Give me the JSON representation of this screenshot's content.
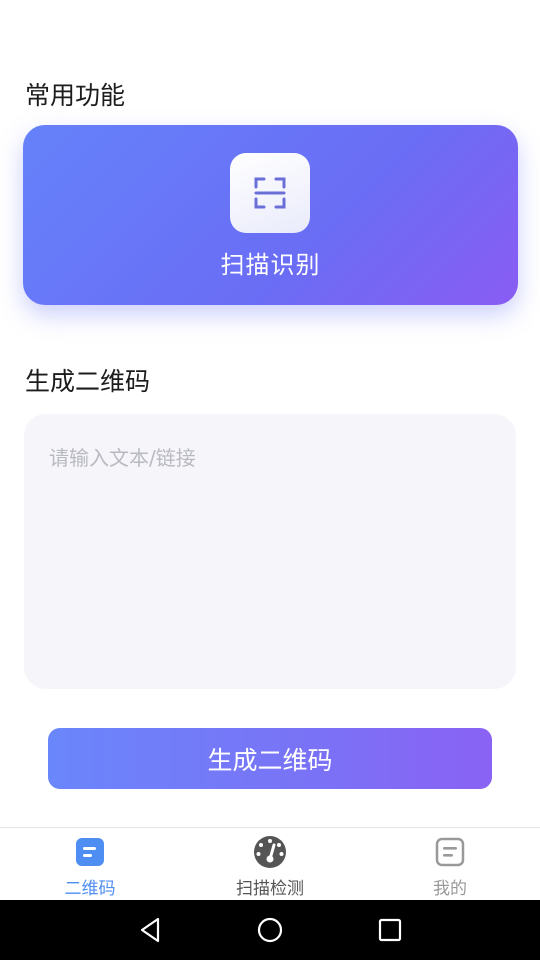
{
  "sections": {
    "common_title": "常用功能",
    "generate_title": "生成二维码"
  },
  "scan_card": {
    "label": "扫描识别",
    "icon": "scan-frame-icon"
  },
  "input": {
    "value": "",
    "placeholder": "请输入文本/链接"
  },
  "generate_button": {
    "label": "生成二维码"
  },
  "tabbar": {
    "items": [
      {
        "label": "二维码",
        "icon": "qrcode-tab-icon",
        "active": true
      },
      {
        "label": "扫描检测",
        "icon": "gauge-icon",
        "active": false
      },
      {
        "label": "我的",
        "icon": "profile-card-icon",
        "active": false
      }
    ]
  },
  "colors": {
    "accent": "#4e8ef3",
    "card_gradient_start": "#6582fa",
    "card_gradient_end": "#8a5cf3",
    "input_bg": "#f5f5fa"
  }
}
